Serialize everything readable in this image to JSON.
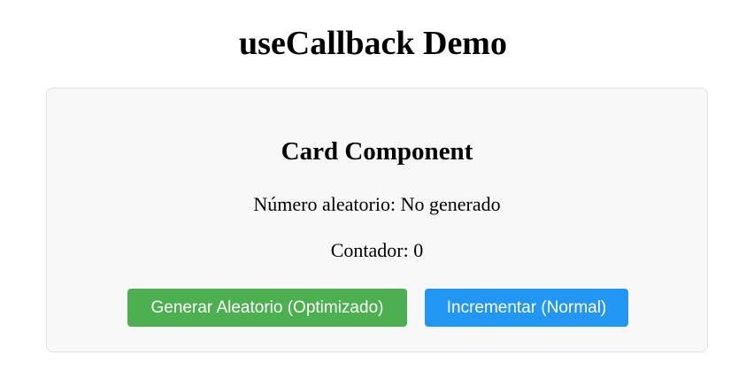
{
  "page": {
    "title": "useCallback Demo"
  },
  "card": {
    "title": "Card Component",
    "random_label": "Número aleatorio: ",
    "random_value": "No generado",
    "counter_label": "Contador: ",
    "counter_value": "0"
  },
  "buttons": {
    "generate_label": "Generar Aleatorio (Optimizado)",
    "increment_label": "Incrementar (Normal)"
  },
  "colors": {
    "generate_button": "#4caf50",
    "increment_button": "#2196f3",
    "card_background": "#f8f8f8"
  }
}
